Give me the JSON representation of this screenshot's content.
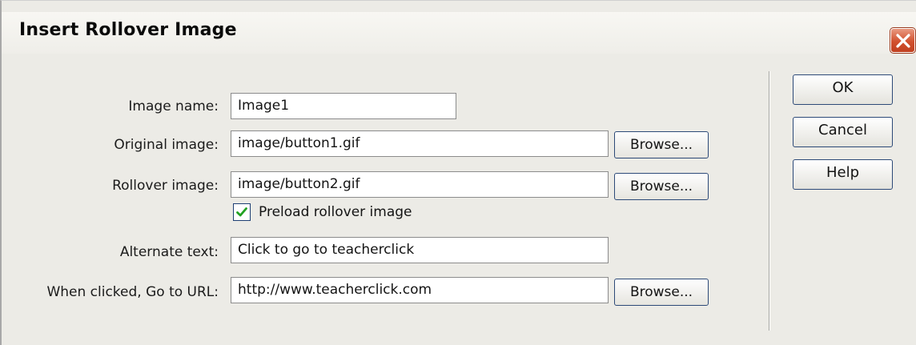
{
  "window": {
    "title": "Insert Rollover Image",
    "close_icon": "close-x-icon"
  },
  "form": {
    "image_name": {
      "label": "Image name:",
      "value": "Image1"
    },
    "original_image": {
      "label": "Original image:",
      "value": "image/button1.gif",
      "browse_label": "Browse..."
    },
    "rollover_image": {
      "label": "Rollover image:",
      "value": "image/button2.gif",
      "browse_label": "Browse..."
    },
    "preload": {
      "label": "Preload rollover image",
      "checked": true
    },
    "alternate_text": {
      "label": "Alternate text:",
      "value": "Click to go to teacherclick"
    },
    "url": {
      "label": "When clicked, Go to URL:",
      "value": "http://www.teacherclick.com",
      "browse_label": "Browse..."
    }
  },
  "buttons": {
    "ok": "OK",
    "cancel": "Cancel",
    "help": "Help"
  },
  "colors": {
    "dialog_bg": "#ecebe6",
    "button_border": "#2d4a78",
    "close_button": "#d2512f",
    "checkmark": "#21a121"
  }
}
